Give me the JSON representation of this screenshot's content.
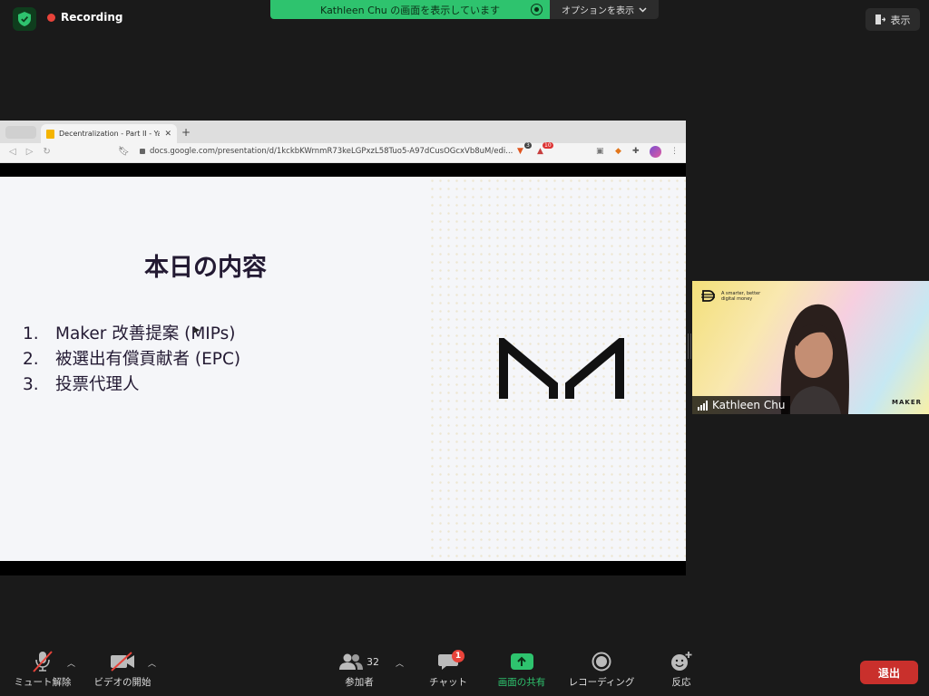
{
  "top_bar": {
    "recording_label": "Recording",
    "share_banner_text": "Kathleen Chu の画面を表示しています",
    "options_label": "オプションを表示",
    "view_label": "表示"
  },
  "browser": {
    "tab_title": "Decentralization - Part II - Yasa...",
    "url": "docs.google.com/presentation/d/1kckbKWrnmR73keLGPxzL58Tuo5-A97dCusOGcxVb8uM/edi...",
    "ext_badges": [
      "3",
      "10"
    ]
  },
  "slide": {
    "title": "本日の内容",
    "items": [
      {
        "num": "1.",
        "text": "Maker 改善提案 (MIPs)"
      },
      {
        "num": "2.",
        "text": "被選出有償貢献者 (EPC)"
      },
      {
        "num": "3.",
        "text": "投票代理人"
      }
    ]
  },
  "participant": {
    "name": "Kathleen Chu",
    "brand_tagline_1": "A smarter, better",
    "brand_tagline_2": "digital money",
    "brand_name": "MAKER"
  },
  "controls": {
    "mute_label": "ミュート解除",
    "video_label": "ビデオの開始",
    "participants_label": "参加者",
    "participants_count": "32",
    "chat_label": "チャット",
    "chat_badge": "1",
    "share_label": "画面の共有",
    "record_label": "レコーディング",
    "reactions_label": "反応",
    "leave_label": "退出"
  },
  "colors": {
    "zoom_green": "#2ec36e",
    "record_red": "#e8433a",
    "leave_red": "#c9302c",
    "background": "#1a1a1a",
    "slide_text": "#231a33"
  },
  "icons": [
    "shield-icon",
    "record-dot-icon",
    "view-icon",
    "mic-muted-icon",
    "video-off-icon",
    "participants-icon",
    "chat-icon",
    "share-screen-icon",
    "record-icon",
    "reactions-icon",
    "maker-logo-icon",
    "signal-bars-icon"
  ]
}
